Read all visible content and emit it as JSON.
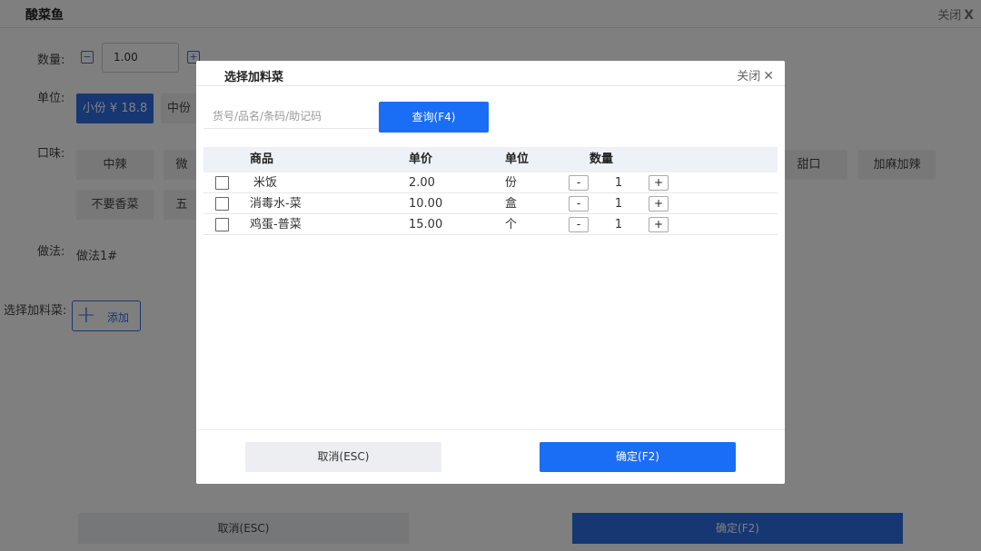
{
  "background": {
    "title": "酸菜鱼",
    "close_label": "关闭",
    "close_icon": "X",
    "quantity": {
      "label": "数量:",
      "minus_icon": "−",
      "value": "1.00",
      "plus_icon": "+"
    },
    "unit": {
      "label": "单位:",
      "options": [
        "小份 ¥ 18.8",
        "中份"
      ],
      "selected": "小份 ¥ 18.8"
    },
    "flavor": {
      "label": "口味:",
      "options_visible": [
        "中辣",
        "微",
        "甜口",
        "加麻加辣",
        "不要香菜",
        "五"
      ]
    },
    "method": {
      "label": "做法:",
      "value": "做法1#"
    },
    "addon": {
      "label": "选择加料菜:",
      "add_label": "添加",
      "add_icon": "+"
    },
    "cancel_label": "取消(ESC)",
    "ok_label": "确定(F2)",
    "accent_color": "#2f6fe4"
  },
  "modal": {
    "title": "选择加料菜",
    "close_label": "关闭",
    "close_icon": "✕",
    "search": {
      "placeholder": "货号/品名/条码/助记码",
      "button_label": "查询(F4)"
    },
    "table": {
      "headers": {
        "name": "商品",
        "price": "单价",
        "unit": "单位",
        "qty": "数量"
      },
      "rows": [
        {
          "name": "米饭",
          "price": "2.00",
          "unit": "份",
          "qty": "1",
          "checked": false
        },
        {
          "name": "消毒水-菜",
          "price": "10.00",
          "unit": "盒",
          "qty": "1",
          "checked": false
        },
        {
          "name": "鸡蛋-普菜",
          "price": "15.00",
          "unit": "个",
          "qty": "1",
          "checked": false
        }
      ],
      "minus_label": "-",
      "plus_label": "+"
    },
    "cancel_label": "取消(ESC)",
    "ok_label": "确定(F2)",
    "primary_color": "#1a6ef5"
  }
}
